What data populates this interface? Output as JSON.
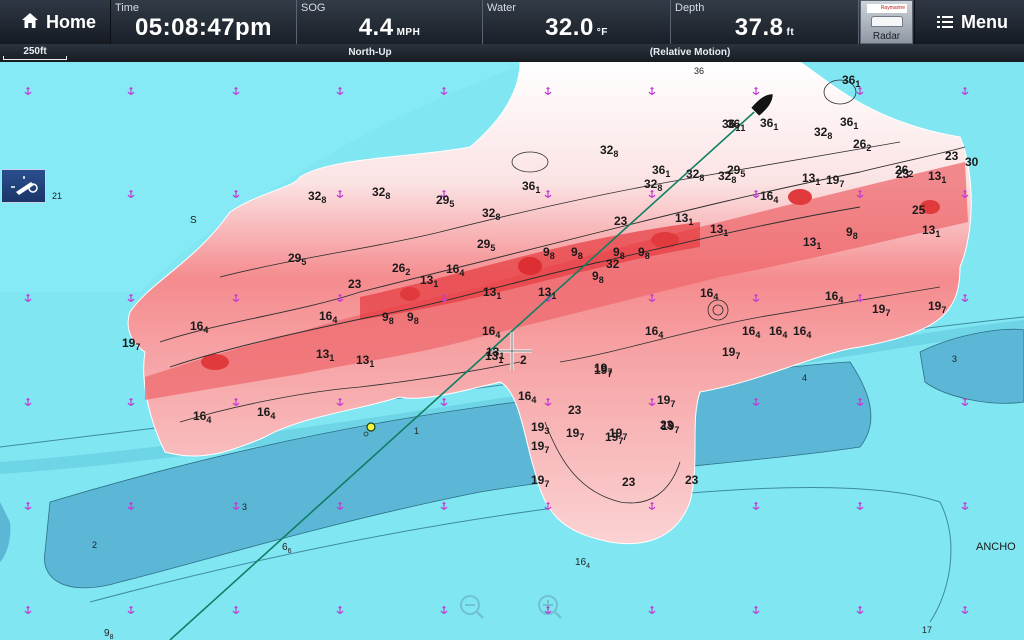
{
  "header": {
    "home_label": "Home",
    "menu_label": "Menu",
    "time": {
      "label": "Time",
      "value": "05:08:47pm"
    },
    "sog": {
      "label": "SOG",
      "value": "4.4",
      "unit": "MPH"
    },
    "water": {
      "label": "Water",
      "value": "32.0",
      "unit": "°F"
    },
    "depth": {
      "label": "Depth",
      "value": "37.8",
      "unit": "ft"
    },
    "radar": {
      "label": "Radar",
      "brand": "Raymarine"
    }
  },
  "status_strip": {
    "scale": "250ft",
    "orientation": "North-Up",
    "motion": "(Relative Motion)"
  },
  "chart": {
    "map_depths": [
      "36",
      "21",
      "3",
      "4",
      "2",
      "3",
      "1",
      "17"
    ],
    "map_labels": [
      "S",
      "ANCHO"
    ],
    "soundings": [
      {
        "main": "6",
        "sub": "6"
      },
      {
        "main": "16",
        "sub": "4"
      },
      {
        "main": "9",
        "sub": "8"
      }
    ],
    "contour_labels": [
      {
        "main": "36",
        "sub": "1"
      },
      {
        "main": "36",
        "sub": "1"
      },
      {
        "main": "32",
        "sub": "8"
      },
      {
        "main": "36",
        "sub": "1"
      },
      {
        "main": "36",
        "sub": "1"
      },
      {
        "main": "36",
        "sub": "1"
      },
      {
        "main": "32",
        "sub": "8"
      },
      {
        "main": "32",
        "sub": "8"
      },
      {
        "main": "29",
        "sub": "5"
      },
      {
        "main": "26",
        "sub": "2"
      },
      {
        "main": "23",
        "sub": ""
      },
      {
        "main": "30",
        "sub": ""
      },
      {
        "main": "13",
        "sub": "1"
      },
      {
        "main": "19",
        "sub": "7"
      },
      {
        "main": "13",
        "sub": "1"
      },
      {
        "main": "32",
        "sub": "8"
      },
      {
        "main": "32",
        "sub": "8"
      },
      {
        "main": "32",
        "sub": "8"
      },
      {
        "main": "32",
        "sub": "8"
      },
      {
        "main": "29",
        "sub": "5"
      },
      {
        "main": "16",
        "sub": "4"
      },
      {
        "main": "25",
        "sub": ""
      },
      {
        "main": "9",
        "sub": "8"
      },
      {
        "main": "13",
        "sub": "1"
      },
      {
        "main": "13",
        "sub": "1"
      },
      {
        "main": "29",
        "sub": "5"
      },
      {
        "main": "36",
        "sub": "1"
      },
      {
        "main": "32",
        "sub": "8"
      },
      {
        "main": "26",
        "sub": "2"
      },
      {
        "main": "23",
        "sub": ""
      },
      {
        "main": "13",
        "sub": "1"
      },
      {
        "main": "13",
        "sub": "1"
      },
      {
        "main": "29",
        "sub": "5"
      },
      {
        "main": "26",
        "sub": "2"
      },
      {
        "main": "16",
        "sub": "4"
      },
      {
        "main": "9",
        "sub": "8"
      },
      {
        "main": "9",
        "sub": "8"
      },
      {
        "main": "9",
        "sub": "8"
      },
      {
        "main": "9",
        "sub": "8"
      },
      {
        "main": "32",
        "sub": ""
      },
      {
        "main": "9",
        "sub": "8"
      },
      {
        "main": "23",
        "sub": ""
      },
      {
        "main": "13",
        "sub": "1"
      },
      {
        "main": "13",
        "sub": "1"
      },
      {
        "main": "13",
        "sub": "1"
      },
      {
        "main": "16",
        "sub": "4"
      },
      {
        "main": "16",
        "sub": "4"
      },
      {
        "main": "19",
        "sub": "7"
      },
      {
        "main": "19",
        "sub": "7"
      },
      {
        "main": "23",
        "sub": ""
      },
      {
        "main": "16",
        "sub": "4"
      },
      {
        "main": "9",
        "sub": "8"
      },
      {
        "main": "9",
        "sub": "8"
      },
      {
        "main": "16",
        "sub": "4"
      },
      {
        "main": "16",
        "sub": "4"
      },
      {
        "main": "16",
        "sub": "4"
      },
      {
        "main": "16",
        "sub": "4"
      },
      {
        "main": "16",
        "sub": "4"
      },
      {
        "main": "19",
        "sub": "7"
      },
      {
        "main": "16",
        "sub": "4"
      },
      {
        "main": "19",
        "sub": "7"
      },
      {
        "main": "13",
        "sub": "1"
      },
      {
        "main": "13",
        "sub": "1"
      },
      {
        "main": "13",
        "sub": "1"
      },
      {
        "main": "16",
        "sub": "4"
      },
      {
        "main": "16",
        "sub": "4"
      },
      {
        "main": "19",
        "sub": "7"
      },
      {
        "main": "16",
        "sub": "4"
      },
      {
        "main": "19",
        "sub": "7"
      },
      {
        "main": "23",
        "sub": ""
      },
      {
        "main": "19",
        "sub": "3"
      },
      {
        "main": "19",
        "sub": "7"
      },
      {
        "main": "19",
        "sub": "7"
      },
      {
        "main": "19",
        "sub": "7"
      },
      {
        "main": "19",
        "sub": "7"
      },
      {
        "main": "19",
        "sub": "7"
      },
      {
        "main": "19",
        "sub": "7"
      },
      {
        "main": "23",
        "sub": ""
      },
      {
        "main": "23",
        "sub": ""
      },
      {
        "main": "23",
        "sub": ""
      },
      {
        "main": "19",
        "sub": "7"
      },
      {
        "main": "13",
        "sub": "1"
      },
      {
        "main": "2",
        "sub": ""
      },
      {
        "main": "36",
        "sub": "1"
      }
    ]
  },
  "colors": {
    "shallow_water": "#7fe6f2",
    "deep_channel": "#5cb7d6",
    "sonar_shallow": "#e8383b",
    "sonar_deep": "#ffffff",
    "track": "#0e7f63"
  },
  "icons": {
    "home": "home-icon",
    "menu": "menu-icon",
    "cursor_mode": "boat-cursor-icon",
    "anchorage": "anchor-marker-icon",
    "zoom_in": "zoom-in-icon",
    "zoom_out": "zoom-out-icon",
    "waypoint": "waypoint-icon",
    "vessel": "vessel-icon"
  }
}
